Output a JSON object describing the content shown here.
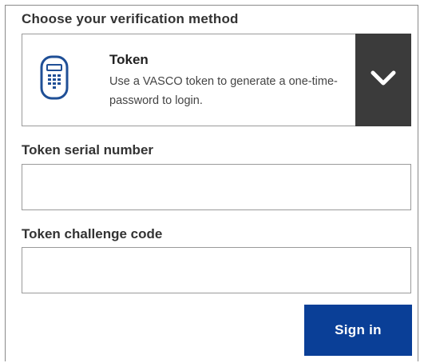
{
  "heading": "Choose your verification method",
  "method": {
    "title": "Token",
    "description": "Use a VASCO token to generate a one-time-password to login.",
    "icon": "token-device-icon",
    "toggle_icon": "chevron-down-icon"
  },
  "fields": {
    "serial": {
      "label": "Token serial number",
      "value": "",
      "placeholder": ""
    },
    "challenge": {
      "label": "Token challenge code",
      "value": "",
      "placeholder": ""
    }
  },
  "actions": {
    "signin_label": "Sign in"
  },
  "colors": {
    "brand_blue": "#0a3f97",
    "icon_blue": "#1f4f96",
    "toggle_bg": "#3b3b3b",
    "text_dark": "#333333"
  }
}
